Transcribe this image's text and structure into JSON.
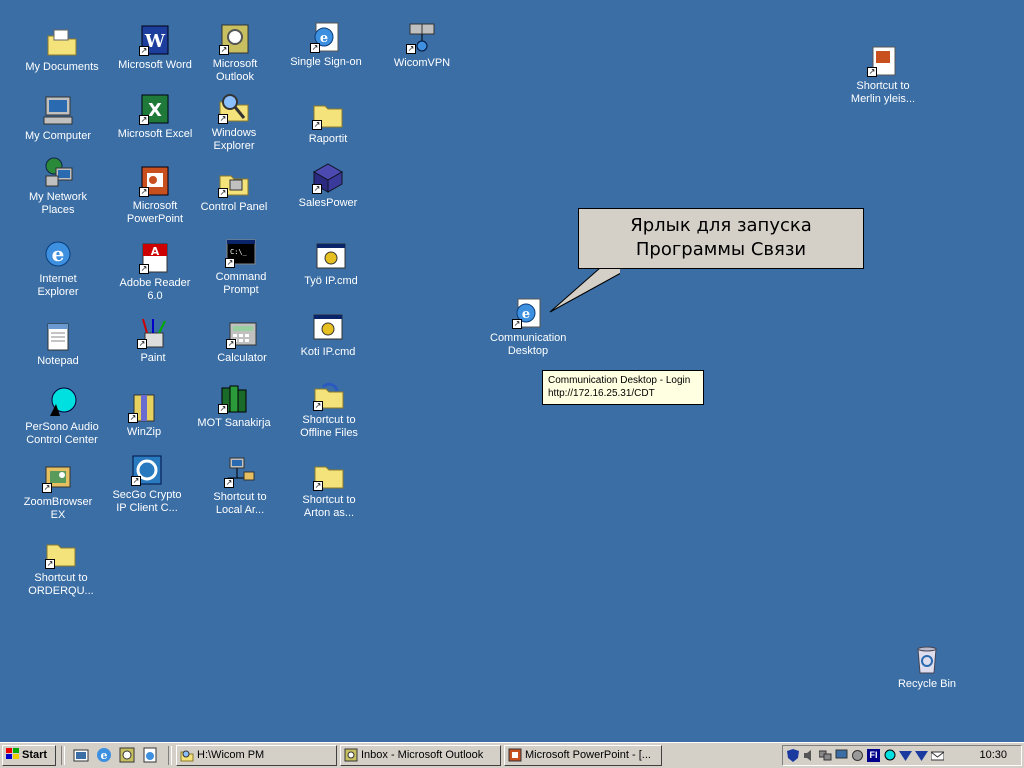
{
  "desktop": {
    "icons": [
      {
        "label": "My Documents"
      },
      {
        "label": "My Computer"
      },
      {
        "label": "My Network Places"
      },
      {
        "label": "Internet Explorer"
      },
      {
        "label": "Notepad"
      },
      {
        "label": "PerSono Audio Control Center"
      },
      {
        "label": "ZoomBrowser EX"
      },
      {
        "label": "Shortcut to ORDERQU..."
      },
      {
        "label": "Microsoft Word"
      },
      {
        "label": "Microsoft Excel"
      },
      {
        "label": "Microsoft PowerPoint"
      },
      {
        "label": "Adobe Reader 6.0"
      },
      {
        "label": "Paint"
      },
      {
        "label": "WinZip"
      },
      {
        "label": "SecGo Crypto IP Client C..."
      },
      {
        "label": "Microsoft Outlook"
      },
      {
        "label": "Windows Explorer"
      },
      {
        "label": "Control Panel"
      },
      {
        "label": "Command Prompt"
      },
      {
        "label": "Calculator"
      },
      {
        "label": "MOT Sanakirja"
      },
      {
        "label": "Shortcut to Local Ar..."
      },
      {
        "label": "Single Sign-on"
      },
      {
        "label": "Raportit"
      },
      {
        "label": "SalesPower"
      },
      {
        "label": "Työ IP.cmd"
      },
      {
        "label": "Koti IP.cmd"
      },
      {
        "label": "Shortcut to Offline Files"
      },
      {
        "label": "Shortcut to Arton as..."
      },
      {
        "label": "WicomVPN"
      },
      {
        "label": "Shortcut to Merlin yleis..."
      },
      {
        "label": "Communication Desktop"
      },
      {
        "label": "Recycle Bin"
      }
    ],
    "callout": {
      "line1": "Ярлык для запуска",
      "line2": "Программы Связи"
    },
    "tooltip": {
      "line1": "Communication Desktop - Login",
      "line2": "http://172.16.25.31/CDT"
    }
  },
  "taskbar": {
    "start_label": "Start",
    "tasks": [
      {
        "label": "H:\\Wicom PM"
      },
      {
        "label": "Inbox - Microsoft Outlook"
      },
      {
        "label": "Microsoft PowerPoint - [..."
      }
    ],
    "tray_lang": "FI",
    "clock": "10:30"
  }
}
